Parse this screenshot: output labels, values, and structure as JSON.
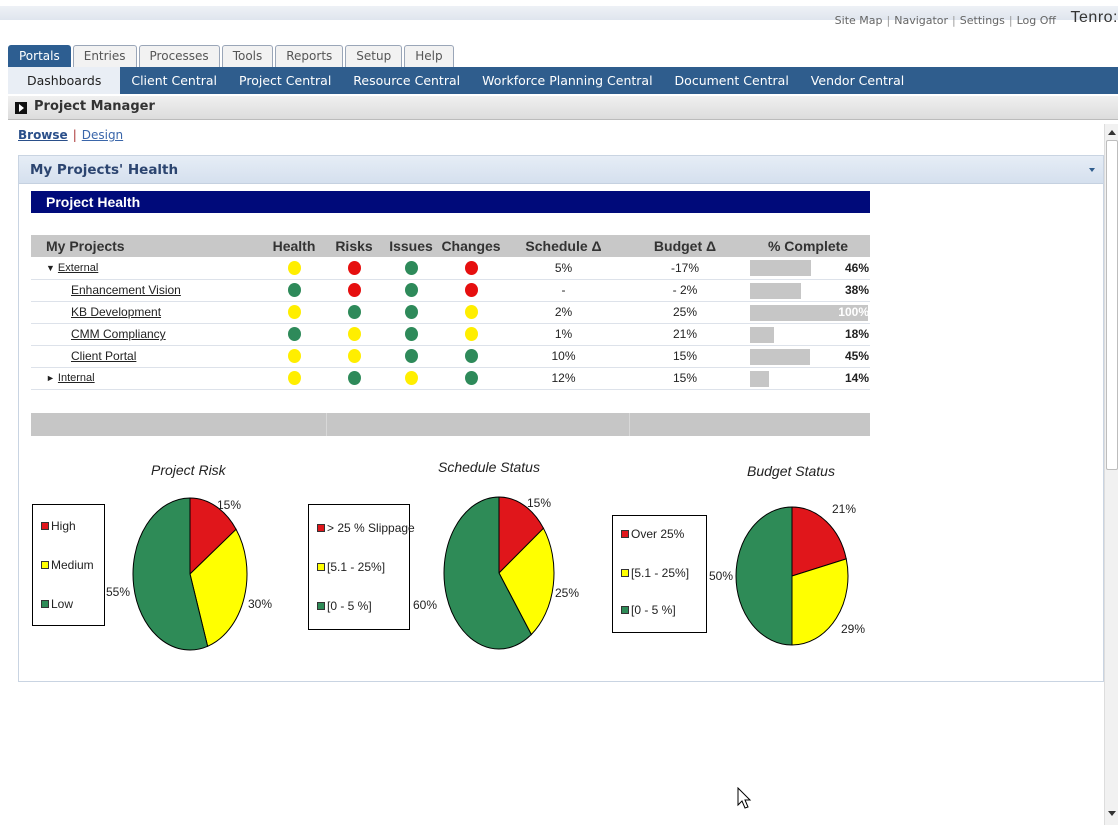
{
  "top": {
    "links": [
      "Site Map",
      "Navigator",
      "Settings",
      "Log Off"
    ],
    "brand": "Tenro:"
  },
  "main_tabs": [
    "Portals",
    "Entries",
    "Processes",
    "Tools",
    "Reports",
    "Setup",
    "Help"
  ],
  "sub_nav": [
    "Dashboards",
    "Client Central",
    "Project Central",
    "Resource Central",
    "Workforce Planning Central",
    "Document Central",
    "Vendor Central"
  ],
  "page": {
    "title": "Project Manager",
    "view_browse": "Browse",
    "view_design": "Design",
    "portlet_title": "My Projects' Health"
  },
  "health": {
    "banner": "Project Health",
    "columns": [
      "My Projects",
      "Health",
      "Risks",
      "Issues",
      "Changes",
      "Schedule Δ",
      "Budget Δ",
      "% Complete"
    ],
    "rows": [
      {
        "name": "External",
        "group": true,
        "arrow": "▼",
        "health": "yellow",
        "risks": "red",
        "issues": "green",
        "changes": "red",
        "schedule": "5%",
        "budget": "-17%",
        "complete": 0.46,
        "complete_label": "46%"
      },
      {
        "name": "Enhancement Vision",
        "group": false,
        "health": "green",
        "risks": "red",
        "issues": "green",
        "changes": "red",
        "schedule": "-",
        "budget": "- 2%",
        "complete": 0.38,
        "complete_label": "38%"
      },
      {
        "name": "KB Development",
        "group": false,
        "health": "yellow",
        "risks": "green",
        "issues": "green",
        "changes": "yellow",
        "schedule": "2%",
        "budget": "25%",
        "complete": 1.0,
        "complete_label": "100%"
      },
      {
        "name": "CMM Compliancy",
        "group": false,
        "health": "green",
        "risks": "yellow",
        "issues": "green",
        "changes": "yellow",
        "schedule": "1%",
        "budget": "21%",
        "complete": 0.18,
        "complete_label": "18%"
      },
      {
        "name": "Client Portal",
        "group": false,
        "health": "yellow",
        "risks": "yellow",
        "issues": "green",
        "changes": "green",
        "schedule": "10%",
        "budget": "15%",
        "complete": 0.45,
        "complete_label": "45%"
      },
      {
        "name": "Internal",
        "group": true,
        "arrow": "►",
        "health": "yellow",
        "risks": "green",
        "issues": "yellow",
        "changes": "green",
        "schedule": "12%",
        "budget": "15%",
        "complete": 0.14,
        "complete_label": "14%"
      }
    ]
  },
  "colors": {
    "red": "#e0161b",
    "yellow": "#ffff00",
    "green": "#2e8b57",
    "status_red": "#e60f0f",
    "status_yellow": "#ffee00",
    "status_green": "#2e8a5a",
    "nav_blue": "#2f5d8d",
    "banner_navy": "#000a7a"
  },
  "chart_data": [
    {
      "type": "pie",
      "title": "Project Risk",
      "slices": [
        {
          "label": "High",
          "value": 15,
          "color": "#e0161b"
        },
        {
          "label": "Medium",
          "value": 30,
          "color": "#ffff00"
        },
        {
          "label": "Low",
          "value": 55,
          "color": "#2e8b57"
        }
      ],
      "slice_labels": [
        "15%",
        "30%",
        "55%"
      ]
    },
    {
      "type": "pie",
      "title": "Schedule Status",
      "slices": [
        {
          "label": "> 25 % Slippage",
          "value": 15,
          "color": "#e0161b"
        },
        {
          "label": "[5.1 - 25%]",
          "value": 25,
          "color": "#ffff00"
        },
        {
          "label": "[0 - 5 %]",
          "value": 60,
          "color": "#2e8b57"
        }
      ],
      "slice_labels": [
        "15%",
        "25%",
        "60%"
      ]
    },
    {
      "type": "pie",
      "title": "Budget Status",
      "slices": [
        {
          "label": "Over 25%",
          "value": 21,
          "color": "#e0161b"
        },
        {
          "label": "[5.1 - 25%]",
          "value": 29,
          "color": "#ffff00"
        },
        {
          "label": "[0 - 5 %]",
          "value": 50,
          "color": "#2e8b57"
        }
      ],
      "slice_labels": [
        "21%",
        "29%",
        "50%"
      ]
    }
  ]
}
